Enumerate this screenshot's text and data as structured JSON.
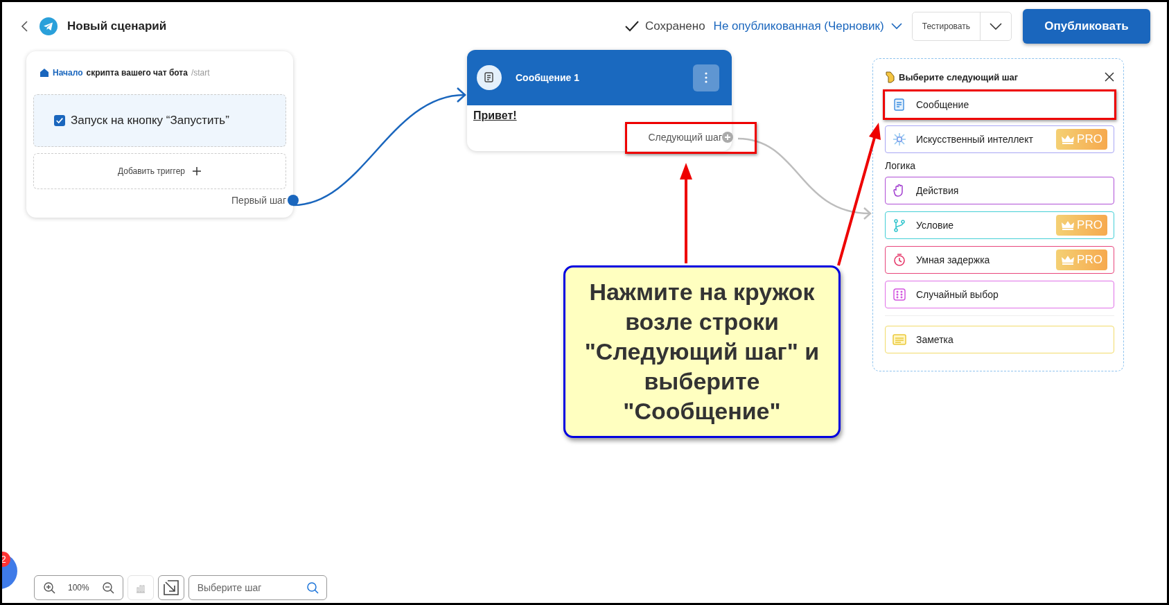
{
  "header": {
    "title": "Новый сценарий",
    "save_status": "Сохранено",
    "publish_status": "Не опубликованная (Черновик)",
    "test_button": "Тестировать",
    "publish_button": "Опубликовать"
  },
  "start_node": {
    "title_link": "Начало",
    "title": "скрипта вашего чат бота",
    "command": "/start",
    "trigger": {
      "label": "Запуск на кнопку “Запустить”",
      "checked": true
    },
    "add_trigger": "Добавить триггер",
    "port_label": "Первый шаг"
  },
  "message_node": {
    "title": "Сообщение 1",
    "text": "Привет!",
    "port_label": "Следующий шаг",
    "highlighted": true
  },
  "step_panel": {
    "title": "Выберите следующий шаг",
    "items": [
      {
        "kind": "message",
        "label": "Сообщение",
        "highlighted": true
      },
      {
        "kind": "ai",
        "label": "Искусственный интеллект",
        "color": "#a8a6f4",
        "badge": "PRO",
        "highlighted": false
      },
      {
        "kind": "heading",
        "label": "Логика"
      },
      {
        "kind": "actions",
        "label": "Действия",
        "color": "#b04fd6",
        "highlighted": false
      },
      {
        "kind": "condition",
        "label": "Условие",
        "color": "#43cfd6",
        "badge": "PRO",
        "highlighted": false
      },
      {
        "kind": "delay",
        "label": "Умная задержка",
        "color": "#e8467c",
        "badge": "PRO",
        "highlighted": false
      },
      {
        "kind": "random",
        "label": "Случайный выбор",
        "color": "#e070e8",
        "highlighted": false
      },
      {
        "kind": "divider"
      },
      {
        "kind": "note",
        "label": "Заметка",
        "color": "#f2dc6a",
        "highlighted": false
      }
    ]
  },
  "callout": {
    "text": "Нажмите на кружок\nвозле строки\n\"Следующий шаг\" и\nвыберите\n\"Сообщение\""
  },
  "toolbar": {
    "zoom": "100%",
    "stats_disabled": true,
    "search_placeholder": "Выберите шаг"
  },
  "chat_widget": {
    "badge": "2"
  }
}
